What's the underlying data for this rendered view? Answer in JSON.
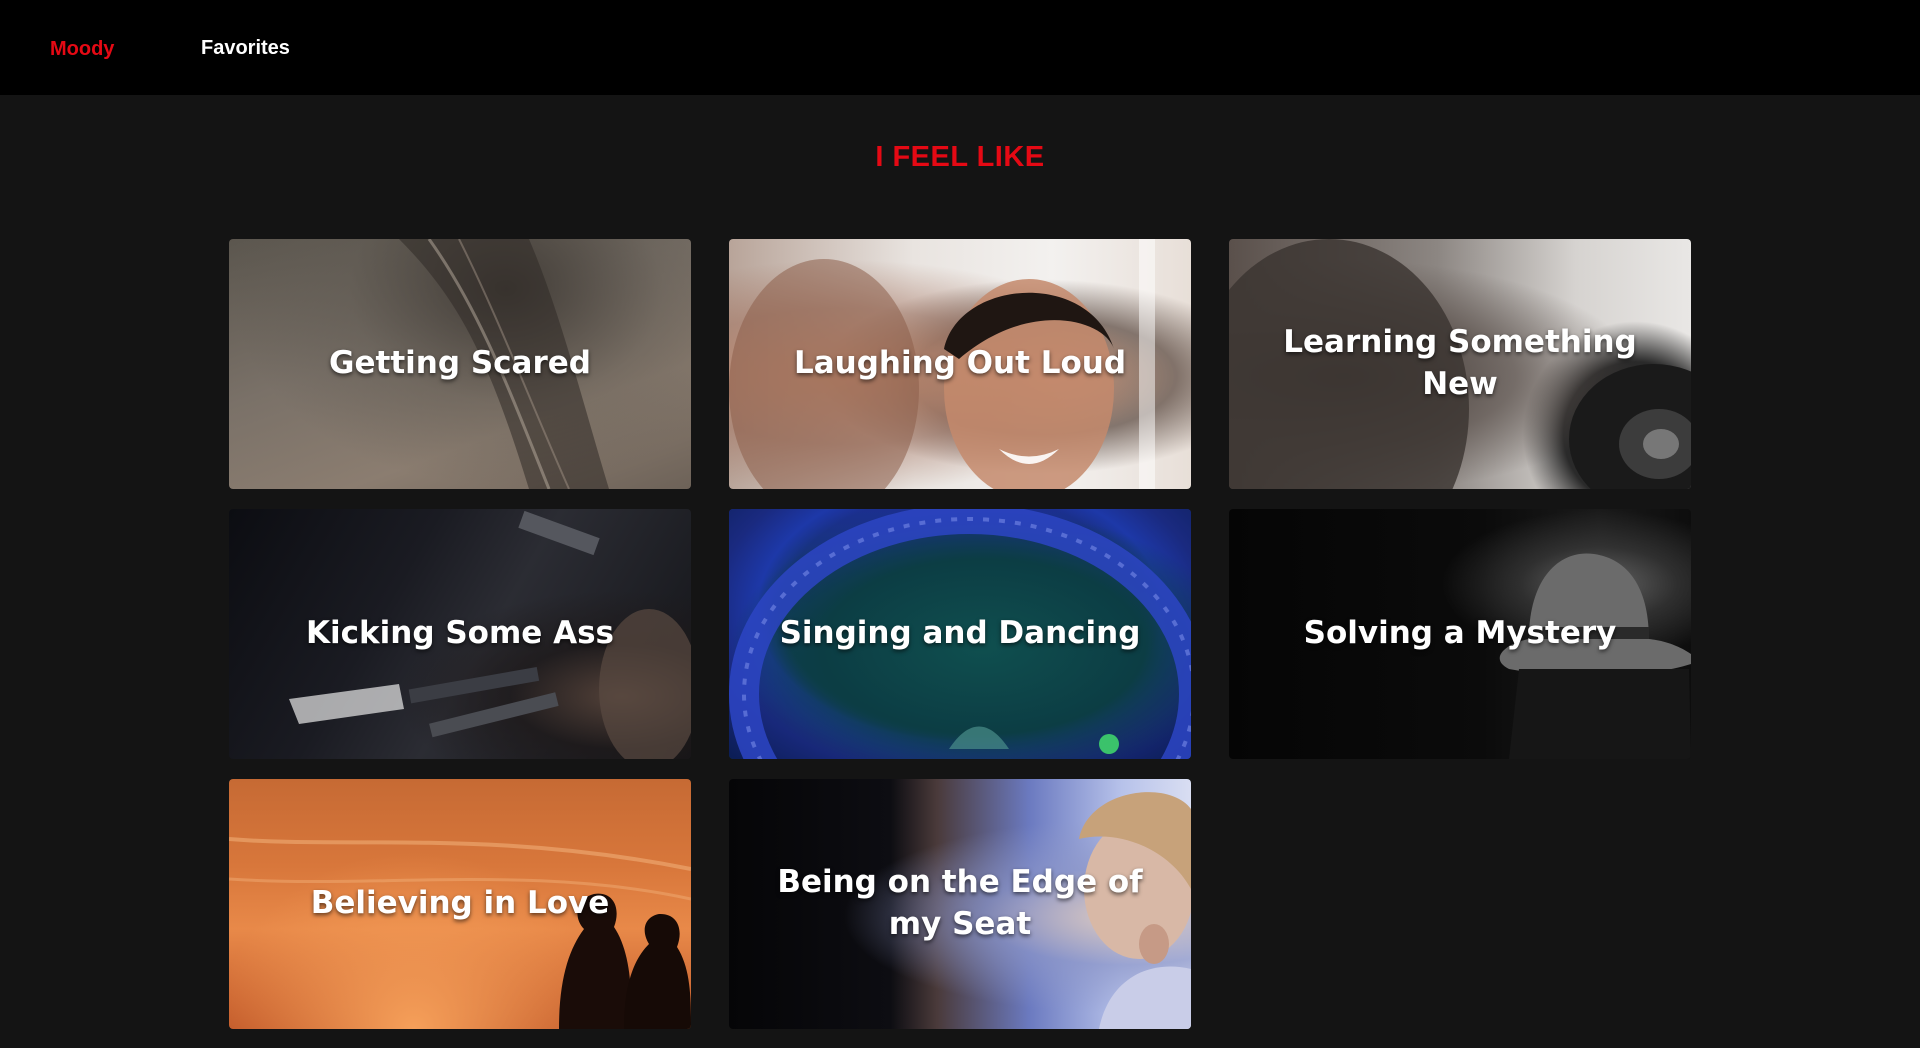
{
  "nav": {
    "brand": "Moody",
    "favorites": "Favorites"
  },
  "headline": "I FEEL LIKE",
  "colors": {
    "accent": "#e50914",
    "background": "#141414",
    "topbar": "#000000"
  },
  "moods": [
    {
      "label": "Getting Scared"
    },
    {
      "label": "Laughing Out Loud"
    },
    {
      "label": "Learning Something New"
    },
    {
      "label": "Kicking Some Ass"
    },
    {
      "label": "Singing and Dancing"
    },
    {
      "label": "Solving a Mystery"
    },
    {
      "label": "Believing in Love"
    },
    {
      "label": "Being on the Edge of my Seat"
    }
  ]
}
